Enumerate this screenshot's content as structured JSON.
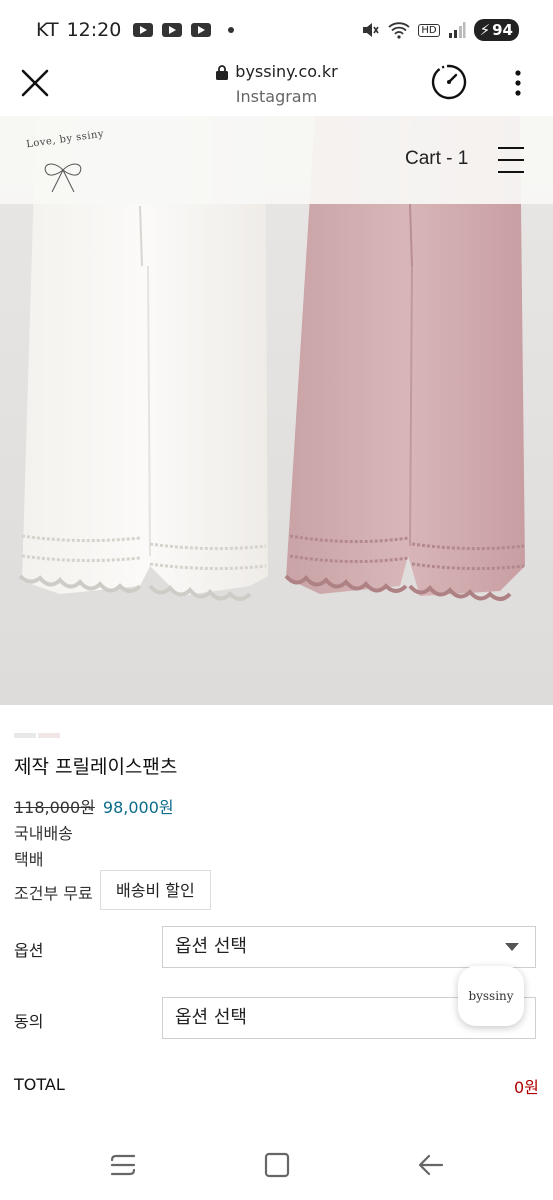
{
  "status_bar": {
    "carrier": "KT",
    "time": "12:20",
    "battery": "94",
    "hd": "HD"
  },
  "browser": {
    "url": "byssiny.co.kr",
    "source": "Instagram"
  },
  "site": {
    "logo_text": "Love, by ssiny",
    "cart": "Cart - 1"
  },
  "product": {
    "title": "제작 프릴레이스팬츠",
    "price_original": "118,000원",
    "price_sale": "98,000원",
    "shipping_domestic": "국내배송",
    "shipping_method": "택배",
    "shipping_condition": "조건부 무료",
    "shipping_discount": "배송비 할인"
  },
  "options": [
    {
      "label": "옵션",
      "value": "옵션 선택"
    },
    {
      "label": "동의",
      "value": "옵션 선택"
    }
  ],
  "float_button": "byssiny",
  "total": {
    "label": "TOTAL",
    "value": "0원"
  },
  "colors": {
    "sale_price": "#0b6b8a",
    "total_value": "#b00000"
  }
}
